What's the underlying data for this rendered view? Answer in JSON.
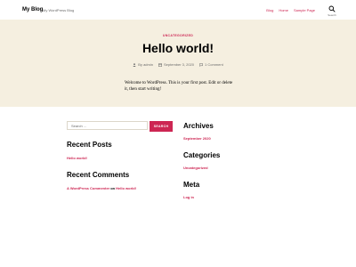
{
  "header": {
    "site_title": "My Blog",
    "site_description": "My WordPress Blog",
    "nav": [
      "Blog",
      "Home",
      "Sample Page"
    ],
    "search_label": "Search"
  },
  "post": {
    "category": "UNCATEGORIZED",
    "title": "Hello world!",
    "meta": {
      "author": "By admin",
      "date": "September 3, 2020",
      "comments": "1 Comment"
    },
    "excerpt": "Welcome to WordPress. This is your first post. Edit or delete it, then start writing!"
  },
  "sidebar_left": {
    "search_placeholder": "Search ...",
    "search_button": "SEARCH",
    "recent_posts_title": "Recent Posts",
    "recent_posts": [
      "Hello world!"
    ],
    "recent_comments_title": "Recent Comments",
    "comment_author": "A WordPress Commenter",
    "comment_on": "on",
    "comment_post": "Hello world!"
  },
  "sidebar_right": {
    "archives_title": "Archives",
    "archives": [
      "September 2020"
    ],
    "categories_title": "Categories",
    "categories": [
      "Uncategorized"
    ],
    "meta_title": "Meta",
    "meta_links": [
      "Log in"
    ]
  },
  "colors": {
    "accent": "#cd2653",
    "hero_bg": "#f5efe0",
    "muted": "#6d6d6d"
  }
}
